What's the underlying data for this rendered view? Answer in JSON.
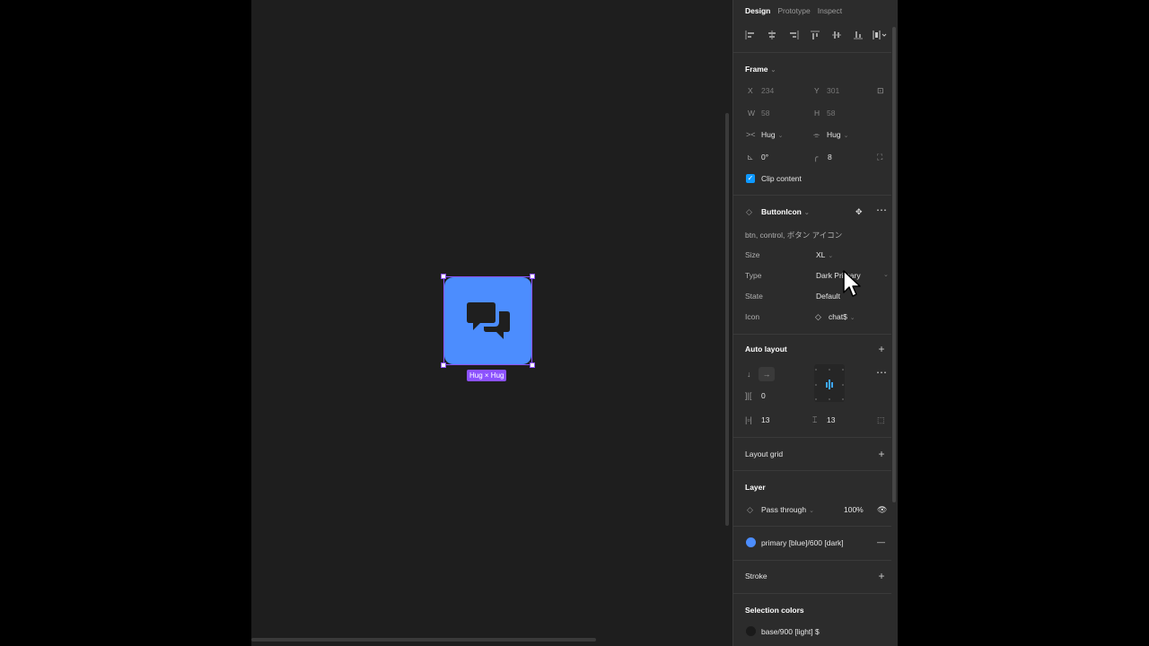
{
  "canvas": {
    "selection_tag": "Hug × Hug",
    "component_color": "#4c8dfe",
    "selection_color": "#8c52ff"
  },
  "panel": {
    "tabs": [
      "Design",
      "Prototype",
      "Inspect"
    ],
    "frame": {
      "title": "Frame",
      "x_label": "X",
      "x": "234",
      "y_label": "Y",
      "y": "301",
      "w_label": "W",
      "w": "58",
      "h_label": "H",
      "h": "58",
      "hug_h": "Hug",
      "hug_v": "Hug",
      "rotation": "0°",
      "radius": "8",
      "clip_label": "Clip content"
    },
    "component": {
      "name": "ButtonIcon",
      "description": "btn, control, ボタン アイコン",
      "size_label": "Size",
      "size": "XL",
      "type_label": "Type",
      "type": "Dark Primary",
      "state_label": "State",
      "state": "Default",
      "icon_label": "Icon",
      "icon": "chat$"
    },
    "auto_layout": {
      "title": "Auto layout",
      "gap": "0",
      "padding_h": "13",
      "padding_v": "13"
    },
    "layout_grid": {
      "title": "Layout grid"
    },
    "layer": {
      "title": "Layer",
      "blend": "Pass through",
      "opacity": "100%"
    },
    "fill": {
      "name": "primary [blue]/600 [dark]",
      "color": "#4c8dfe"
    },
    "stroke": {
      "title": "Stroke"
    },
    "selection_colors": {
      "title": "Selection colors",
      "item": "base/900 [light] $"
    }
  }
}
